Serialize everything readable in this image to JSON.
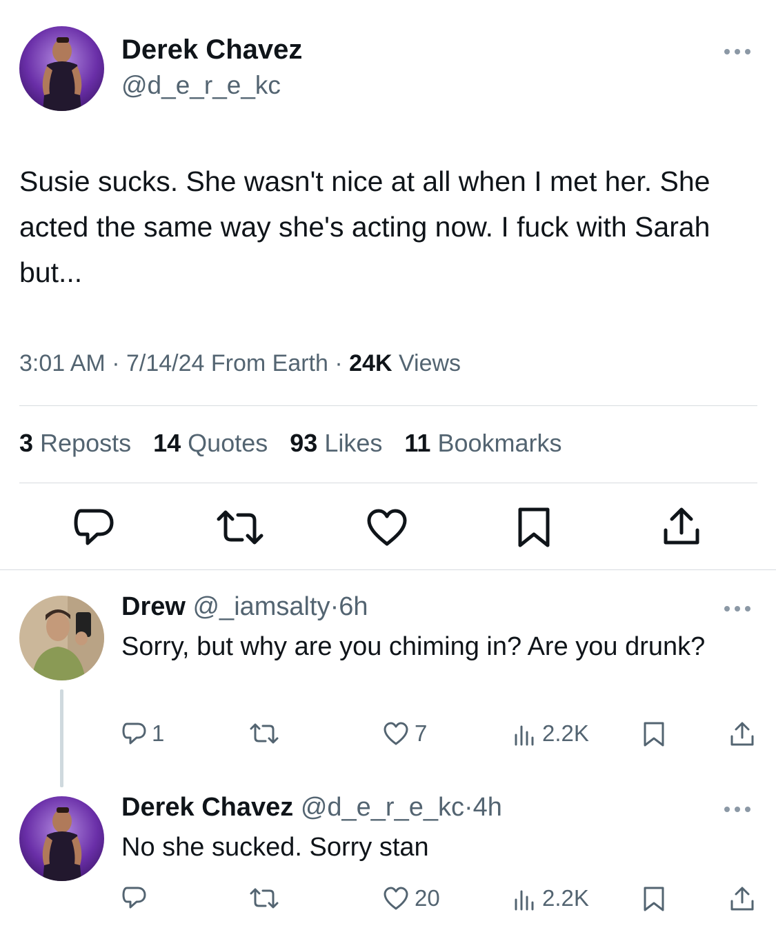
{
  "tweet": {
    "author_name": "Derek Chavez",
    "author_handle": "@d_e_r_e_kc",
    "text": "Susie sucks. She wasn't nice at all when I met her. She acted the same way she's acting now. I fuck with Sarah but...",
    "time": "3:01 AM",
    "sep1": " · ",
    "date": "7/14/24",
    "source": " From Earth",
    "sep2": " · ",
    "views_count": "24K",
    "views_label": " Views",
    "stats": {
      "reposts_count": "3",
      "reposts_label": " Reposts",
      "quotes_count": "14",
      "quotes_label": " Quotes",
      "likes_count": "93",
      "likes_label": " Likes",
      "bookmarks_count": "11",
      "bookmarks_label": " Bookmarks"
    }
  },
  "replies": [
    {
      "author_name": "Drew",
      "author_handle": "@_iamsalty",
      "sep": "·",
      "time": "6h",
      "text": "Sorry, but why are you chiming in? Are you drunk?",
      "reply_count": "1",
      "repost_count": "",
      "like_count": "7",
      "view_count": "2.2K"
    },
    {
      "author_name": "Derek Chavez",
      "author_handle": "@d_e_r_e_kc",
      "sep": "·",
      "time": "4h",
      "text": "No she sucked. Sorry stan",
      "reply_count": "",
      "repost_count": "",
      "like_count": "20",
      "view_count": "2.2K"
    }
  ],
  "colors": {
    "text": "#0f1419",
    "secondary": "#536471",
    "divider": "#d7dbdf",
    "thread_line": "#cfd9de"
  },
  "icons": [
    "more-icon",
    "reply-icon",
    "repost-icon",
    "like-icon",
    "bookmark-icon",
    "share-icon",
    "views-icon"
  ]
}
